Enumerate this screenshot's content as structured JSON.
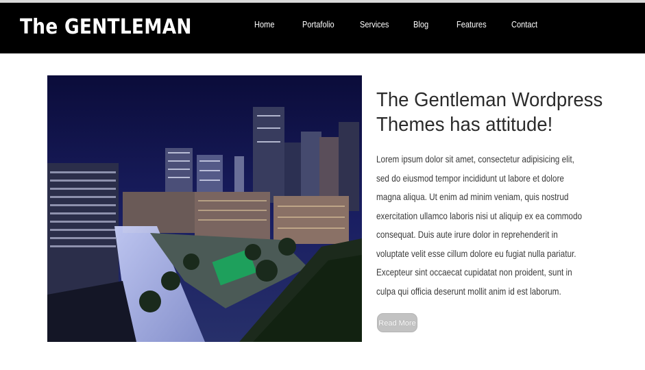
{
  "header": {
    "logo": "The GENTLEMAN",
    "nav": [
      "Home",
      "Portafolio",
      "Services",
      "Blog",
      "Features",
      "Contact"
    ]
  },
  "hero": {
    "title": "The Gentleman Wordpress Themes has attitude!",
    "body": "Lorem ipsum dolor sit amet, consectetur adipisicing elit, sed do eiusmod tempor incididunt ut labore et dolore magna aliqua. Ut enim ad minim veniam, quis nostrud exercitation ullamco laboris nisi ut aliquip ex ea commodo consequat. Duis aute irure dolor in reprehenderit in voluptate velit esse cillum dolore eu fugiat nulla pariatur. Excepteur sint occaecat cupidatat non proident, sunt in culpa qui officia deserunt mollit anim id est laborum.",
    "button": "Read More"
  }
}
